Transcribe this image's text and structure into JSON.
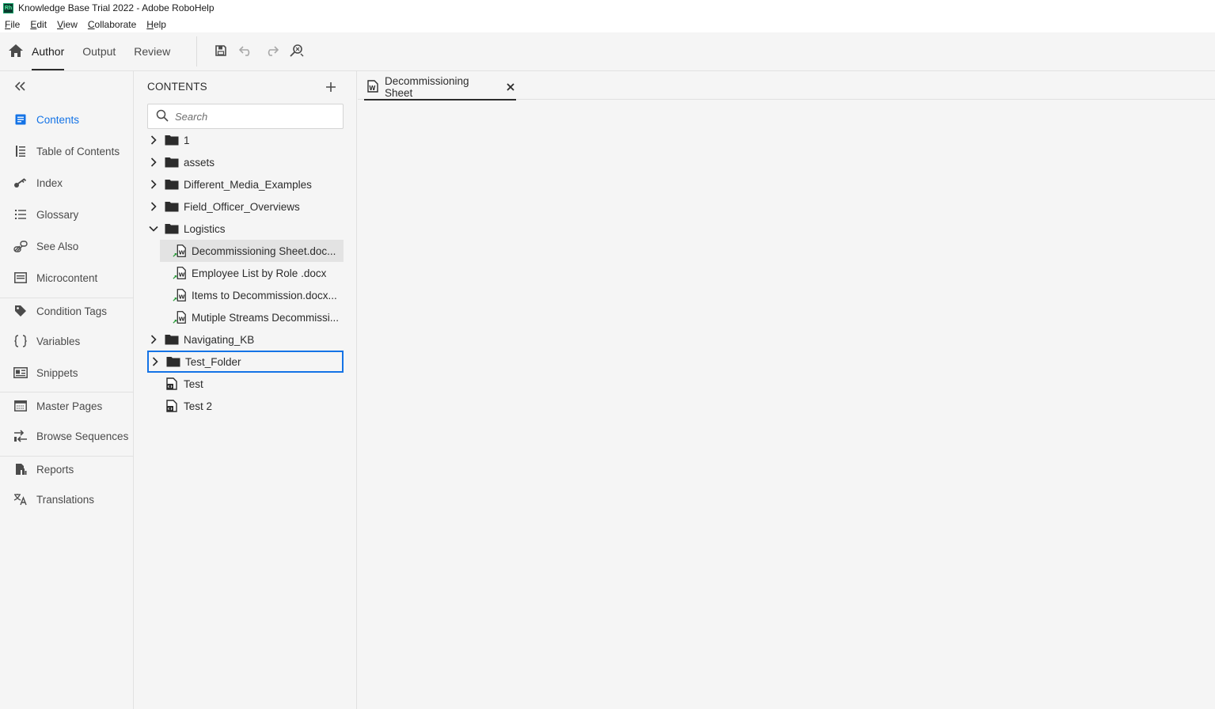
{
  "window": {
    "app_logo": "Rh",
    "title": "Knowledge Base Trial 2022 - Adobe RoboHelp"
  },
  "menubar": [
    {
      "mnemonic": "F",
      "rest": "ile"
    },
    {
      "mnemonic": "E",
      "rest": "dit"
    },
    {
      "mnemonic": "V",
      "rest": "iew"
    },
    {
      "mnemonic": "C",
      "rest": "ollaborate"
    },
    {
      "mnemonic": "H",
      "rest": "elp"
    }
  ],
  "toolbar": {
    "modes": [
      "Author",
      "Output",
      "Review"
    ],
    "active_mode": "Author",
    "icons": [
      "home-icon",
      "save-icon",
      "undo-icon",
      "redo-icon",
      "search-replace-icon"
    ]
  },
  "leftnav": {
    "items": [
      {
        "label": "Contents",
        "icon": "contents-icon",
        "active": true
      },
      {
        "label": "Table of Contents",
        "icon": "toc-icon"
      },
      {
        "label": "Index",
        "icon": "key-icon"
      },
      {
        "label": "Glossary",
        "icon": "glossary-icon"
      },
      {
        "label": "See Also",
        "icon": "see-also-icon"
      },
      {
        "label": "Microcontent",
        "icon": "microcontent-icon"
      },
      {
        "label": "Condition Tags",
        "icon": "tag-icon"
      },
      {
        "label": "Variables",
        "icon": "braces-icon"
      },
      {
        "label": "Snippets",
        "icon": "snippets-icon"
      },
      {
        "label": "Master Pages",
        "icon": "master-pages-icon"
      },
      {
        "label": "Browse Sequences",
        "icon": "browse-sequences-icon"
      },
      {
        "label": "Reports",
        "icon": "reports-icon"
      },
      {
        "label": "Translations",
        "icon": "translations-icon"
      }
    ]
  },
  "contents_panel": {
    "header": "CONTENTS",
    "search_placeholder": "Search",
    "tree": [
      {
        "label": "1",
        "type": "folder",
        "expanded": false
      },
      {
        "label": "assets",
        "type": "folder",
        "expanded": false
      },
      {
        "label": "Different_Media_Examples",
        "type": "folder",
        "expanded": false
      },
      {
        "label": "Field_Officer_Overviews",
        "type": "folder",
        "expanded": false
      },
      {
        "label": "Logistics",
        "type": "folder",
        "expanded": true
      },
      {
        "label": "Decommissioning Sheet.doc...",
        "type": "linked-word-doc",
        "child": true,
        "selected": true
      },
      {
        "label": "Employee List by Role .docx",
        "type": "linked-word-doc",
        "child": true
      },
      {
        "label": "Items to Decommission.docx...",
        "type": "linked-word-doc",
        "child": true
      },
      {
        "label": "Mutiple Streams Decommissi...",
        "type": "linked-word-doc",
        "child": true
      },
      {
        "label": "Navigating_KB",
        "type": "folder",
        "expanded": false
      },
      {
        "label": "Test_Folder",
        "type": "folder",
        "expanded": false,
        "focused": true
      },
      {
        "label": "Test",
        "type": "topic"
      },
      {
        "label": "Test 2",
        "type": "topic"
      }
    ]
  },
  "editor": {
    "tabs": [
      {
        "label": "Decommissioning Sheet",
        "icon": "word-doc-icon"
      }
    ]
  }
}
